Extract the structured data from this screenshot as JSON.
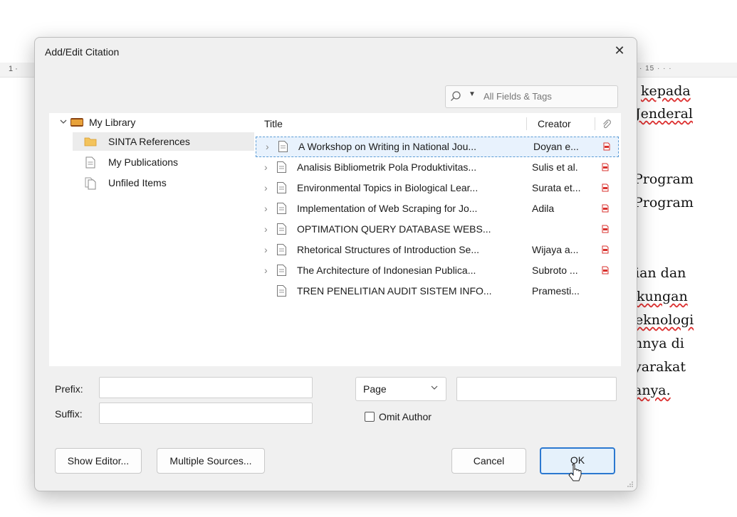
{
  "background_doc": {
    "ruler_left": "1 ·",
    "ruler_right": "· 15 · · ·",
    "lines": [
      "kepada",
      "Jenderal",
      "Program",
      "Program",
      "ian dan",
      "kungan",
      "eknologi",
      "nnya di",
      "yarakat",
      "anya."
    ]
  },
  "dialog": {
    "title": "Add/Edit Citation",
    "close_glyph": "✕",
    "search": {
      "caret": "▼",
      "placeholder": "All Fields & Tags"
    },
    "tree": [
      {
        "label": "My Library"
      },
      {
        "label": "SINTA References"
      },
      {
        "label": "My Publications"
      },
      {
        "label": "Unfiled Items"
      }
    ],
    "columns": {
      "title": "Title",
      "creator": "Creator"
    },
    "items": [
      {
        "title": "A Workshop on Writing in National Jou...",
        "creator": "Doyan e...",
        "twisty": "›",
        "pdf": true
      },
      {
        "title": "Analisis Bibliometrik Pola Produktivitas...",
        "creator": "Sulis et al.",
        "twisty": "›",
        "pdf": true
      },
      {
        "title": "Environmental Topics in Biological Lear...",
        "creator": "Surata et...",
        "twisty": "›",
        "pdf": true
      },
      {
        "title": "Implementation of Web Scraping for Jo...",
        "creator": "Adila",
        "twisty": "›",
        "pdf": true
      },
      {
        "title": "OPTIMATION QUERY DATABASE WEBS...",
        "creator": "",
        "twisty": "›",
        "pdf": true
      },
      {
        "title": "Rhetorical Structures of Introduction Se...",
        "creator": "Wijaya a...",
        "twisty": "›",
        "pdf": true
      },
      {
        "title": "The Architecture of Indonesian Publica...",
        "creator": "Subroto ...",
        "twisty": "›",
        "pdf": true
      },
      {
        "title": "TREN PENELITIAN AUDIT SISTEM INFO...",
        "creator": "Pramesti...",
        "twisty": "",
        "pdf": false
      }
    ],
    "prefix_label": "Prefix:",
    "suffix_label": "Suffix:",
    "prefix_value": "",
    "suffix_value": "",
    "locator": {
      "selected": "Page",
      "value": ""
    },
    "omit_author": {
      "label": "Omit Author",
      "checked": false
    },
    "buttons": {
      "show_editor": "Show Editor...",
      "multiple_sources": "Multiple Sources...",
      "cancel": "Cancel",
      "ok": "OK"
    }
  },
  "colors": {
    "accent": "#2b78d0",
    "selection": "#e8f2fd",
    "pdf_red": "#d9302c",
    "folder": "#e8a23a"
  }
}
